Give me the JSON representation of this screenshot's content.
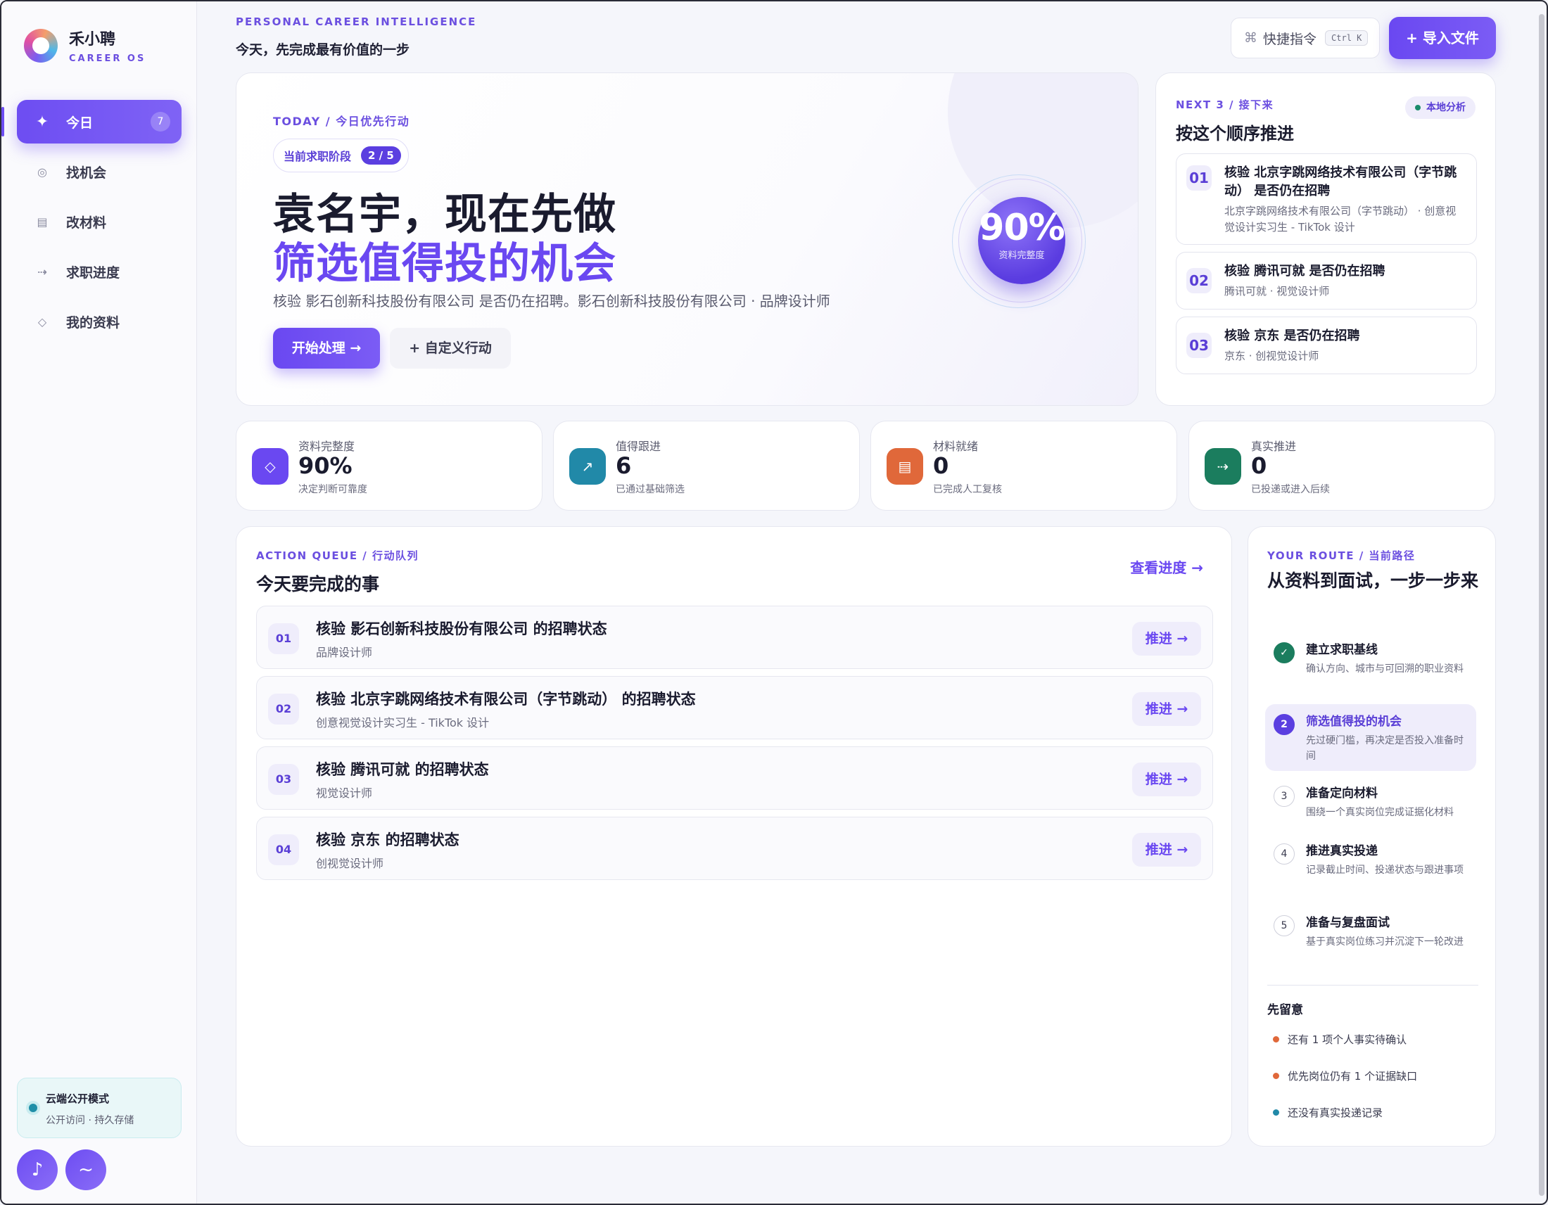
{
  "app": {
    "name": "禾小聘",
    "subtitle": "CAREER OS"
  },
  "sidebar": {
    "items": [
      {
        "label": "今日",
        "icon": "sparkle-icon",
        "badge": "7",
        "active": true
      },
      {
        "label": "找机会",
        "icon": "target-icon"
      },
      {
        "label": "改材料",
        "icon": "document-icon"
      },
      {
        "label": "求职进度",
        "icon": "progress-arrow-icon"
      },
      {
        "label": "我的资料",
        "icon": "diamond-icon"
      }
    ],
    "cloud": {
      "title": "云端公开模式",
      "subtitle": "公开访问 · 持久存储"
    },
    "avatars": [
      {
        "icon": "music-note-icon",
        "glyph": "♪"
      },
      {
        "icon": "wave-icon",
        "glyph": "~"
      }
    ]
  },
  "header": {
    "kicker": "PERSONAL CAREER INTELLIGENCE",
    "headline": "今天，先完成最有价值的一步",
    "command": {
      "label": "快捷指令",
      "shortcut": "Ctrl K"
    },
    "import_label": "+ 导入文件"
  },
  "hero": {
    "kicker": "TODAY / 今日优先行动",
    "stage_label": "当前求职阶段",
    "stage_count": "2 / 5",
    "title_line1": "袁名宇，现在先做",
    "title_line2": "筛选值得投的机会",
    "description": "核验 影石创新科技股份有限公司 是否仍在招聘。影石创新科技股份有限公司 · 品牌设计师",
    "start_label": "开始处理 →",
    "custom_label": "+ 自定义行动",
    "orb_value": "90%",
    "orb_label": "资料完整度"
  },
  "next": {
    "kicker": "NEXT 3 / 接下来",
    "title": "按这个顺序推进",
    "badge": "本地分析",
    "items": [
      {
        "num": "01",
        "title": "核验 北京字跳网络技术有限公司（字节跳动） 是否仍在招聘",
        "sub": "北京字跳网络技术有限公司（字节跳动） · 创意视觉设计实习生 - TikTok 设计"
      },
      {
        "num": "02",
        "title": "核验 腾讯可就 是否仍在招聘",
        "sub": "腾讯可就 · 视觉设计师"
      },
      {
        "num": "03",
        "title": "核验 京东 是否仍在招聘",
        "sub": "京东 · 创视觉设计师"
      }
    ]
  },
  "stats": [
    {
      "label": "资料完整度",
      "value": "90%",
      "sub": "决定判断可靠度",
      "icon": "diamond-icon",
      "glyph": "◇",
      "color": "#6a48f1"
    },
    {
      "label": "值得跟进",
      "value": "6",
      "sub": "已通过基础筛选",
      "icon": "trend-arrow-icon",
      "glyph": "↗",
      "color": "#2189a8"
    },
    {
      "label": "材料就绪",
      "value": "0",
      "sub": "已完成人工复核",
      "icon": "document-icon",
      "glyph": "▤",
      "color": "#e0683a"
    },
    {
      "label": "真实推进",
      "value": "0",
      "sub": "已投递或进入后续",
      "icon": "arrow-right-icon",
      "glyph": "⇢",
      "color": "#1b7d5e"
    }
  ],
  "queue": {
    "kicker": "ACTION QUEUE / 行动队列",
    "title": "今天要完成的事",
    "link": "查看进度 →",
    "action_label": "推进 →",
    "items": [
      {
        "num": "01",
        "title": "核验 影石创新科技股份有限公司 的招聘状态",
        "sub": "品牌设计师"
      },
      {
        "num": "02",
        "title": "核验 北京字跳网络技术有限公司（字节跳动） 的招聘状态",
        "sub": "创意视觉设计实习生 - TikTok 设计"
      },
      {
        "num": "03",
        "title": "核验 腾讯可就 的招聘状态",
        "sub": "视觉设计师"
      },
      {
        "num": "04",
        "title": "核验 京东 的招聘状态",
        "sub": "创视觉设计师"
      }
    ]
  },
  "route": {
    "kicker": "YOUR ROUTE / 当前路径",
    "title": "从资料到面试，一步一步来",
    "steps": [
      {
        "mark": "✓",
        "title": "建立求职基线",
        "sub": "确认方向、城市与可回溯的职业资料",
        "state": "done"
      },
      {
        "mark": "2",
        "title": "筛选值得投的机会",
        "sub": "先过硬门槛，再决定是否投入准备时间",
        "state": "current"
      },
      {
        "mark": "3",
        "title": "准备定向材料",
        "sub": "围绕一个真实岗位完成证据化材料",
        "state": "todo"
      },
      {
        "mark": "4",
        "title": "推进真实投递",
        "sub": "记录截止时间、投递状态与跟进事项",
        "state": "todo"
      },
      {
        "mark": "5",
        "title": "准备与复盘面试",
        "sub": "基于真实岗位练习并沉淀下一轮改进",
        "state": "todo"
      }
    ],
    "notice_title": "先留意",
    "notices": [
      {
        "text": "还有 1 项个人事实待确认",
        "color": "#e0683a"
      },
      {
        "text": "优先岗位仍有 1 个证据缺口",
        "color": "#e0683a"
      },
      {
        "text": "还没有真实投递记录",
        "color": "#2189a8"
      }
    ]
  }
}
